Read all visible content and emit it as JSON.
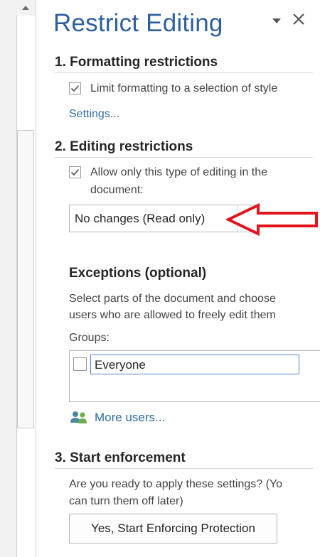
{
  "pane": {
    "title": "Restrict Editing",
    "menu_icon": "chevron-down-icon",
    "close_icon": "close-icon"
  },
  "formatting": {
    "heading": "1. Formatting restrictions",
    "checkbox_label": "Limit formatting to a selection of style",
    "checked": true,
    "settings_link": "Settings..."
  },
  "editing": {
    "heading": "2. Editing restrictions",
    "checkbox_line1": "Allow only this type of editing in the",
    "checkbox_line2": "document:",
    "checked": true,
    "dropdown_value": "No changes (Read only)"
  },
  "exceptions": {
    "heading": "Exceptions (optional)",
    "desc_line1": "Select parts of the document and choose",
    "desc_line2": "users who are allowed to freely edit them",
    "groups_label": "Groups:",
    "groups": [
      {
        "name": "Everyone",
        "checked": false
      }
    ],
    "more_users_link": "More users..."
  },
  "enforcement": {
    "heading": "3. Start enforcement",
    "desc_line1": "Are you ready to apply these settings? (Yo",
    "desc_line2": "can turn them off later)",
    "button_label": "Yes, Start Enforcing Protection"
  },
  "annotation": {
    "arrow_color": "#e3141c"
  },
  "colors": {
    "title": "#2e5f9e",
    "link": "#2f6ea6"
  }
}
